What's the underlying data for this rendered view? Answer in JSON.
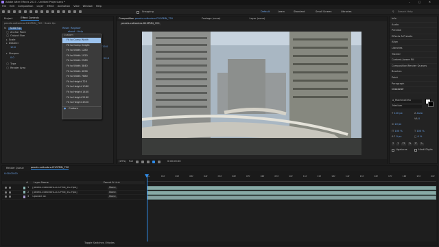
{
  "app": {
    "title": "Adobe After Effects 2023 - Untitled Project.aep *"
  },
  "menu": [
    "File",
    "Edit",
    "Composition",
    "Layer",
    "Effect",
    "Animation",
    "View",
    "Window",
    "Help"
  ],
  "toolbar": {
    "snapping": "Snapping",
    "workspaces": [
      "Default",
      "Learn",
      "Standard",
      "Small Screen",
      "Libraries"
    ],
    "search_placeholder": "Search Help"
  },
  "left_panel": {
    "tabs": [
      "Project",
      "Effect Controls"
    ],
    "breadcrumb": "pexels-cottonbro-D10PMN_720 · Scale Up",
    "effect_name": "Scale Up",
    "reset": "Reset",
    "register": "Register",
    "reg_value": "about · Help",
    "props": [
      {
        "label": "Anchor Point",
        "value": ""
      },
      {
        "label": "Output Size",
        "value": ""
      },
      {
        "label": "Scale",
        "value": ""
      },
      {
        "label": "Sharpen",
        "value": ""
      },
      {
        "label": "Type",
        "value": ""
      },
      {
        "label": "Render Area",
        "value": ""
      }
    ],
    "value_a": "10.0",
    "value_b": "0.0",
    "value_c": "720.0",
    "value_d": "20.0"
  },
  "dropdown": {
    "header": "Custom",
    "items": [
      "Fit to Comp Width",
      "Fit to Comp Height",
      "Fit to Width 1280",
      "Fit to Width 1920",
      "Fit to Width 2560",
      "Fit to Width 3840",
      "Fit to Width 4096",
      "Fit to Width 7680",
      "Fit to Height 720",
      "Fit to Height 1080",
      "Fit to Height 1440",
      "Fit to Height 2160",
      "Fit to Height 4320",
      "Custom"
    ],
    "highlighted_index": 0
  },
  "comp_panel": {
    "tab": "Composition",
    "tab_name": "pexels-cottonbro-D10PMN_720",
    "footage_tab": "Footage (none)",
    "layer_tab": "Layer (none)",
    "sub_tab": "pexels-cottonbro-D10PMN_720",
    "zoom": "(29%)",
    "resolution": "Full",
    "timecode": "0:00:00:00"
  },
  "right_panel": {
    "items": [
      "Info",
      "Audio",
      "Preview",
      "Effects & Presets",
      "Align",
      "Libraries",
      "Tracker",
      "Content-Aware Fill",
      "Composition/Render Queues",
      "Brushes",
      "Paint",
      "Paragraph"
    ],
    "character_title": "Character",
    "font": "a_MachinaOrto",
    "style": "Medium",
    "size": "120 px",
    "leading": "Auto",
    "tracking": "0",
    "stroke": "10 px",
    "scale_v": "100 %",
    "scale_h": "100 %",
    "baseline": "0 px",
    "tsume": "0 %",
    "ligatures": "Ligatures",
    "hindi": "Hindi Digits"
  },
  "timeline": {
    "render_queue": "Render Queue",
    "comp_tab": "pexels-cottonbro-D10PMN_720",
    "timecode": "0:00:00:00",
    "columns": {
      "num": "#",
      "name": "Layer Name",
      "parent": "Parent & Link"
    },
    "layers": [
      {
        "num": "1",
        "name": "[pexels-cottonbro-D10PMN_4K.mp4]",
        "parent": "None"
      },
      {
        "num": "2",
        "name": "[pexels-cottonbro-D10PMN_4K.mp4]",
        "parent": "None"
      },
      {
        "num": "3",
        "name": "Upscale AE",
        "parent": "None"
      }
    ],
    "ticks": [
      "0s",
      "01f",
      "02f",
      "03f",
      "04f",
      "05f",
      "06f",
      "07f",
      "08f",
      "09f",
      "10f",
      "11f",
      "12f",
      "13f",
      "14f",
      "15f",
      "16f",
      "17f",
      "18f",
      "19f",
      "20f"
    ],
    "toggle": "Toggle Switches / Modes"
  },
  "colors": {
    "accent": "#2d8ceb",
    "highlight": "#9cc3ee",
    "track": "#87a9a5"
  }
}
